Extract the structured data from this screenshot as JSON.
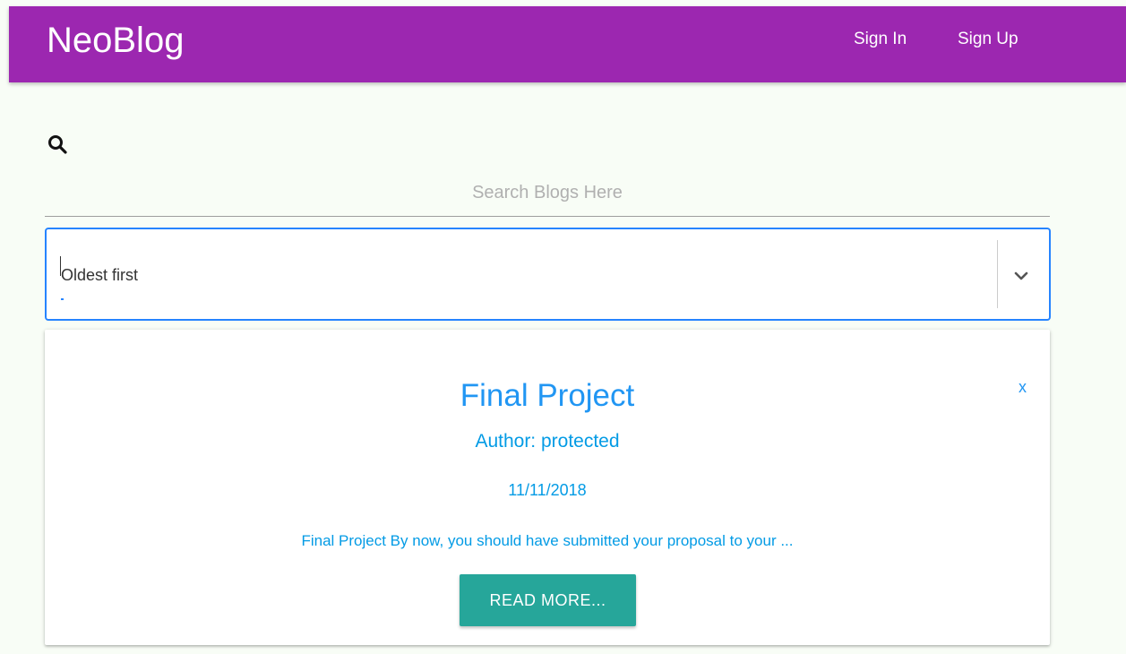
{
  "header": {
    "brand": "NeoBlog",
    "nav": {
      "sign_in": "Sign In",
      "sign_up": "Sign Up"
    },
    "background_color": "#9c27b0"
  },
  "search": {
    "icon": "search-icon",
    "placeholder": "Search Blogs Here",
    "value": ""
  },
  "sort": {
    "selected": "Oldest first",
    "icon": "chevron-down-icon",
    "focus_color": "#2684ff"
  },
  "posts": [
    {
      "title": "Final Project",
      "author": "Author: protected",
      "date": "11/11/2018",
      "excerpt": "Final Project By now, you should have submitted your proposal to your ...",
      "read_more_label": "READ MORE...",
      "close_label": "x",
      "accent_color": "#2196f3",
      "button_color": "#26a69a"
    }
  ]
}
